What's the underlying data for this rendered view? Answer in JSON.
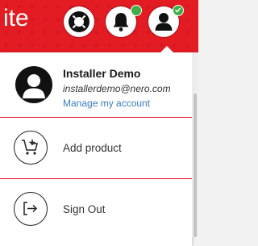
{
  "header": {
    "brand_fragment": "ite",
    "background_color": "#e31b23",
    "buttons": [
      {
        "icon": "lifebuoy-icon"
      },
      {
        "icon": "bell-icon",
        "badge": "green-dot"
      },
      {
        "icon": "user-icon",
        "badge": "green-check"
      }
    ]
  },
  "account": {
    "name": "Installer Demo",
    "email": "installerdemo@nero.com",
    "manage_label": "Manage my account",
    "link_color": "#3a7bbf",
    "avatar_icon": "user-silhouette-icon"
  },
  "menu": {
    "items": [
      {
        "label": "Add product",
        "icon": "cart-add-icon"
      },
      {
        "label": "Sign Out",
        "icon": "sign-out-icon"
      }
    ]
  },
  "colors": {
    "accent": "#e31b23",
    "status_green": "#3fae48"
  }
}
